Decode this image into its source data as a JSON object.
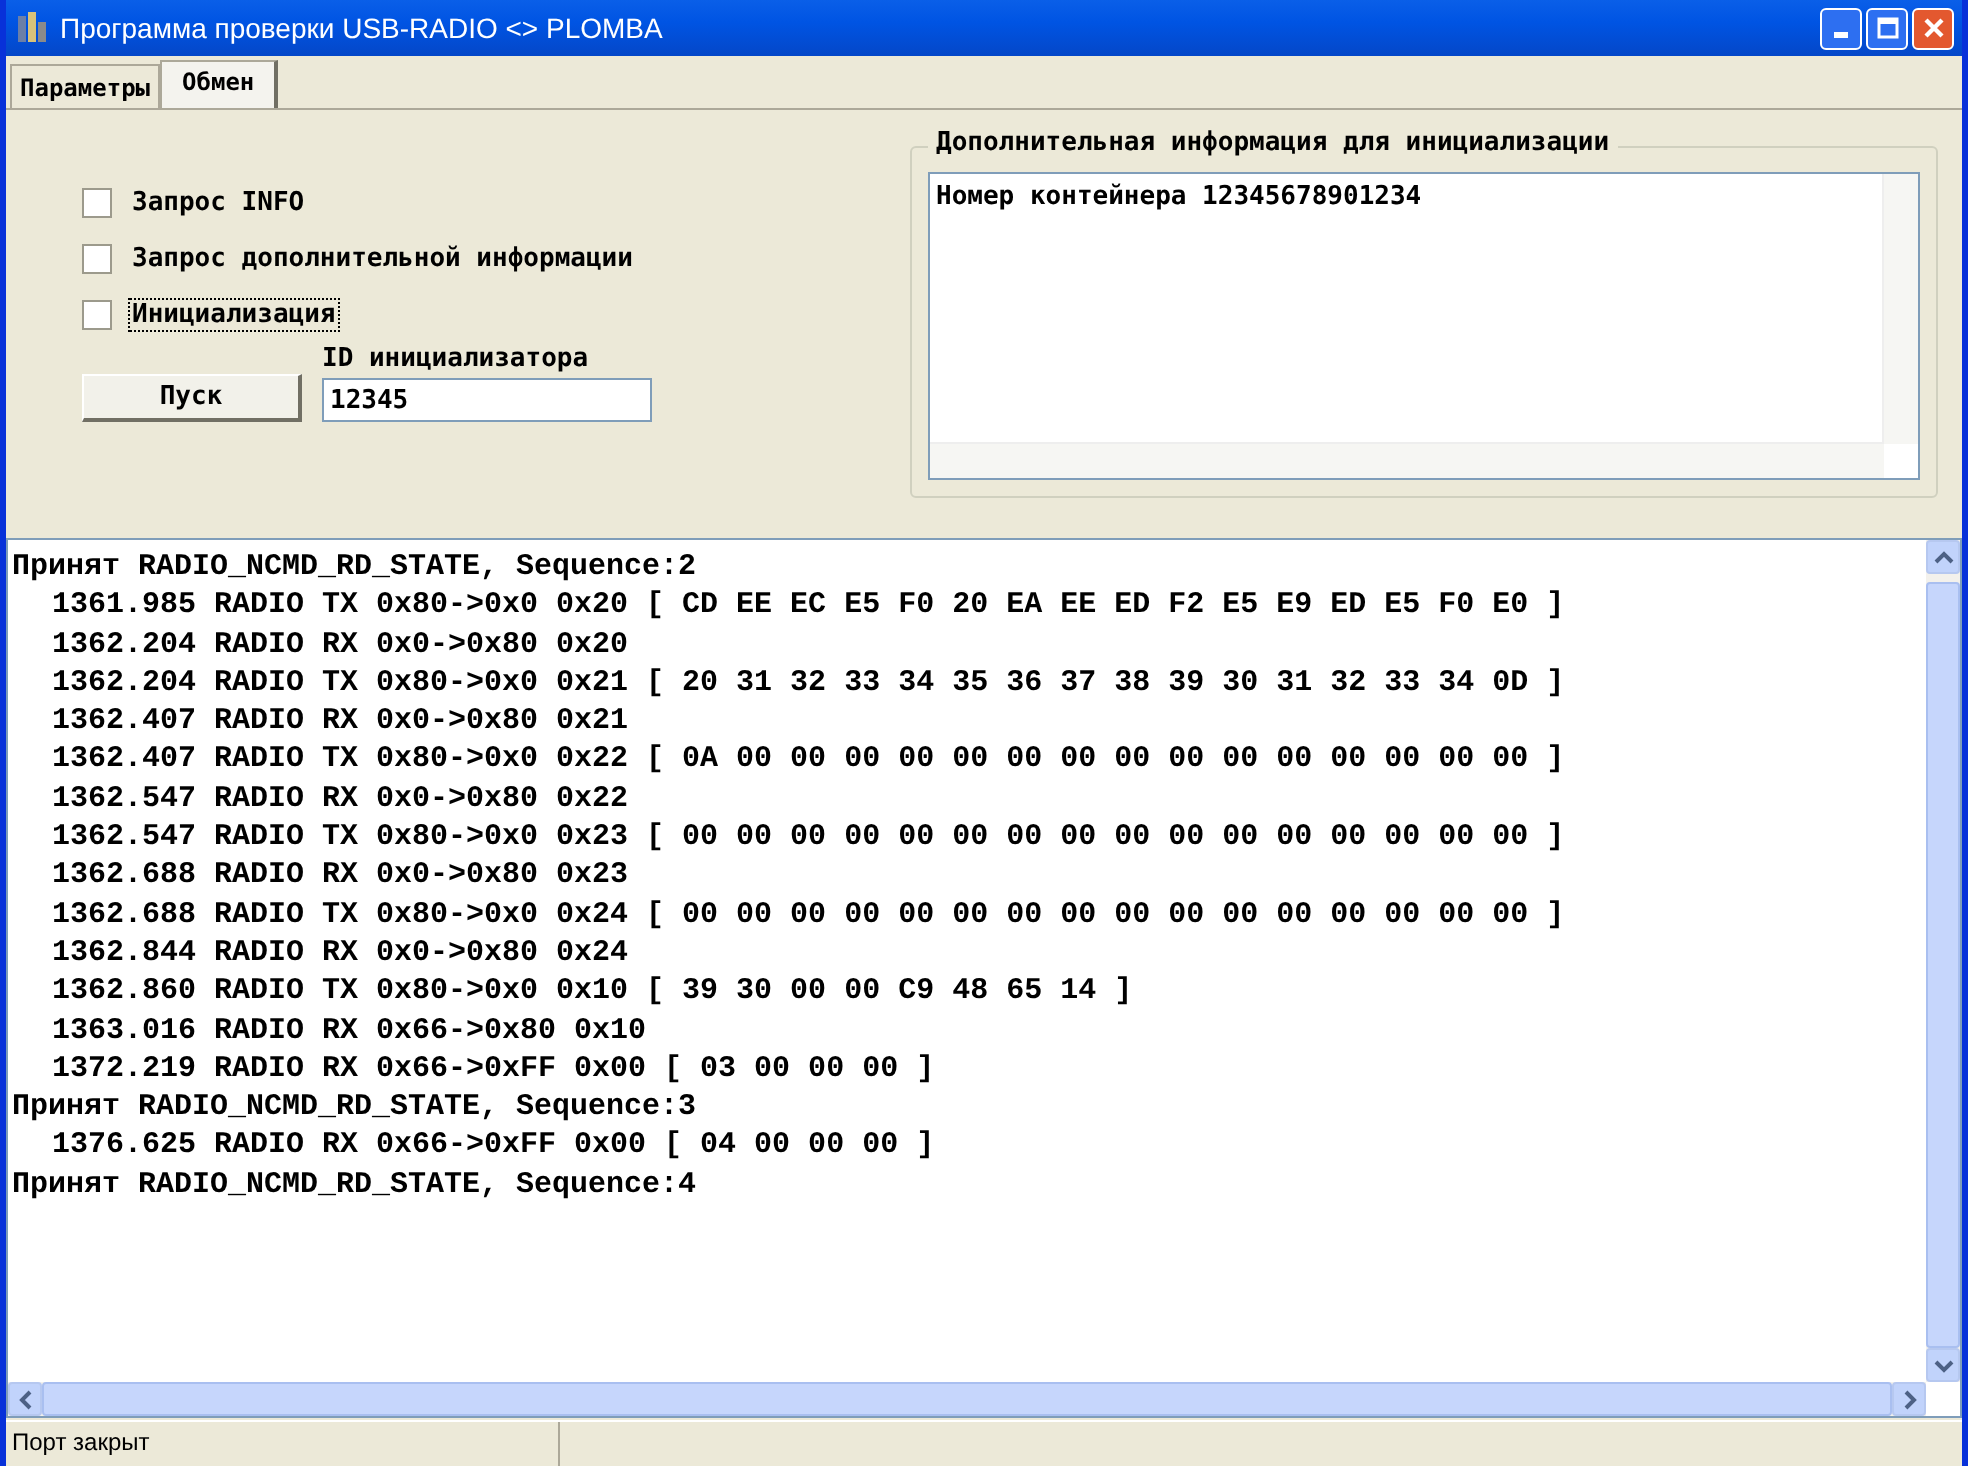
{
  "window": {
    "title": "Программа проверки USB-RADIO <> PLOMBA"
  },
  "tabs": [
    {
      "label": "Параметры",
      "selected": false
    },
    {
      "label": "Обмен",
      "selected": true
    }
  ],
  "checkboxes": [
    {
      "label": "Запрос INFO",
      "checked": false,
      "focused": false
    },
    {
      "label": "Запрос дополнительной информации",
      "checked": false,
      "focused": false
    },
    {
      "label": "Инициализация",
      "checked": false,
      "focused": true
    }
  ],
  "start_button": "Пуск",
  "initiator_id": {
    "label": "ID инициализатора",
    "value": "12345"
  },
  "extra_info": {
    "label": "Дополнительная информация для инициализации",
    "value": "Номер контейнера 12345678901234"
  },
  "log": [
    {
      "kind": "header",
      "text": "Принят RADIO_NCMD_RD_STATE, Sequence:2"
    },
    {
      "kind": "entry",
      "text": "1361.985 RADIO TX 0x80->0x0 0x20 [ CD EE EC E5 F0 20 EA EE ED F2 E5 E9 ED E5 F0 E0 ]"
    },
    {
      "kind": "entry",
      "text": "1362.204 RADIO RX 0x0->0x80 0x20"
    },
    {
      "kind": "entry",
      "text": "1362.204 RADIO TX 0x80->0x0 0x21 [ 20 31 32 33 34 35 36 37 38 39 30 31 32 33 34 0D ]"
    },
    {
      "kind": "entry",
      "text": "1362.407 RADIO RX 0x0->0x80 0x21"
    },
    {
      "kind": "entry",
      "text": "1362.407 RADIO TX 0x80->0x0 0x22 [ 0A 00 00 00 00 00 00 00 00 00 00 00 00 00 00 00 ]"
    },
    {
      "kind": "entry",
      "text": "1362.547 RADIO RX 0x0->0x80 0x22"
    },
    {
      "kind": "entry",
      "text": "1362.547 RADIO TX 0x80->0x0 0x23 [ 00 00 00 00 00 00 00 00 00 00 00 00 00 00 00 00 ]"
    },
    {
      "kind": "entry",
      "text": "1362.688 RADIO RX 0x0->0x80 0x23"
    },
    {
      "kind": "entry",
      "text": "1362.688 RADIO TX 0x80->0x0 0x24 [ 00 00 00 00 00 00 00 00 00 00 00 00 00 00 00 00 ]"
    },
    {
      "kind": "entry",
      "text": "1362.844 RADIO RX 0x0->0x80 0x24"
    },
    {
      "kind": "entry",
      "text": "1362.860 RADIO TX 0x80->0x0 0x10 [ 39 30 00 00 C9 48 65 14 ]"
    },
    {
      "kind": "entry",
      "text": "1363.016 RADIO RX 0x66->0x80 0x10"
    },
    {
      "kind": "entry",
      "text": "1372.219 RADIO RX 0x66->0xFF 0x00 [ 03 00 00 00 ]"
    },
    {
      "kind": "header",
      "text": "Принят RADIO_NCMD_RD_STATE, Sequence:3"
    },
    {
      "kind": "entry",
      "text": "1376.625 RADIO RX 0x66->0xFF 0x00 [ 04 00 00 00 ]"
    },
    {
      "kind": "header",
      "text": "Принят RADIO_NCMD_RD_STATE, Sequence:4"
    }
  ],
  "status_bar": {
    "text": "Порт закрыт"
  }
}
